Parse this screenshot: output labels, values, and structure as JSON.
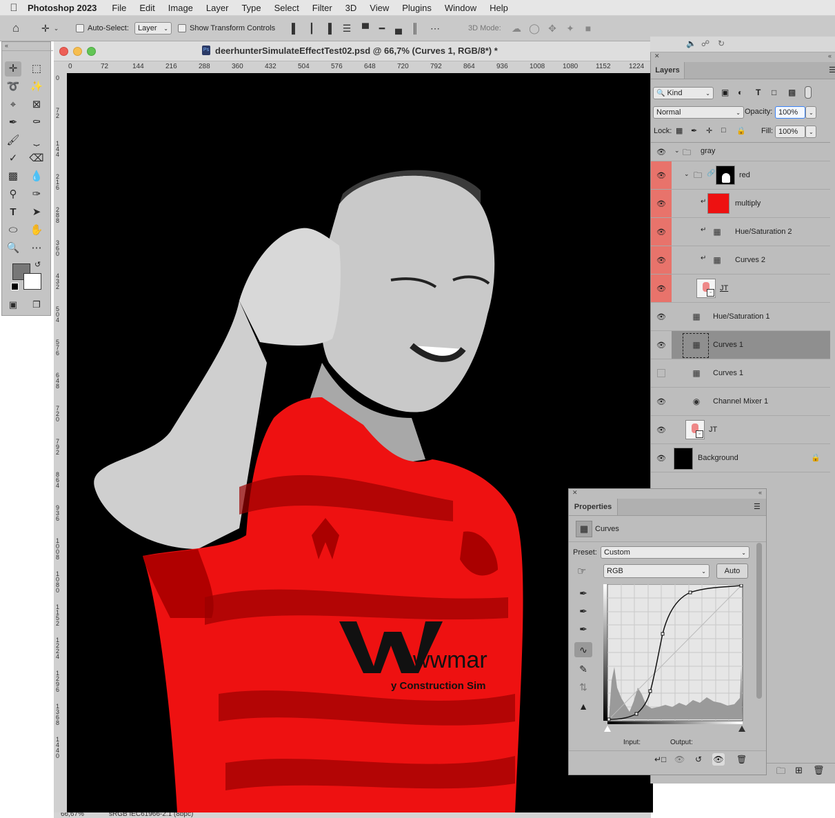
{
  "menubar": {
    "apple_icon": "apple-logo-icon",
    "app_name": "Photoshop 2023",
    "items": [
      "File",
      "Edit",
      "Image",
      "Layer",
      "Type",
      "Select",
      "Filter",
      "3D",
      "View",
      "Plugins",
      "Window",
      "Help"
    ]
  },
  "options_bar": {
    "auto_select_label": "Auto-Select:",
    "auto_select_value": "Layer",
    "show_transform_label": "Show Transform Controls",
    "mode_3d_label": "3D Mode:"
  },
  "document": {
    "title": "deerhunterSimulateEffectTest02.psd @ 66,7% (Curves 1, RGB/8*) *",
    "ruler_top": [
      "0",
      "72",
      "144",
      "216",
      "288",
      "360",
      "432",
      "504",
      "576",
      "648",
      "720",
      "792",
      "864",
      "936",
      "1008",
      "1080",
      "1152",
      "1224"
    ],
    "ruler_left": [
      "0",
      "72",
      "144",
      "216",
      "288",
      "360",
      "432",
      "504",
      "576",
      "648",
      "720",
      "792",
      "864",
      "936",
      "1008",
      "1080",
      "1152",
      "1224",
      "1296",
      "1368",
      "1440"
    ],
    "zoom": "66,67%",
    "color_profile": "sRGB IEC61966-2.1 (8bpc)"
  },
  "layers_panel": {
    "tab": "Layers",
    "filter_kind": "Kind",
    "blend_mode": "Normal",
    "opacity_label": "Opacity:",
    "opacity_value": "100%",
    "lock_label": "Lock:",
    "fill_label": "Fill:",
    "fill_value": "100%",
    "layers": [
      {
        "name": "gray",
        "type": "group"
      },
      {
        "name": "red",
        "type": "group-masked"
      },
      {
        "name": "multiply",
        "type": "fill"
      },
      {
        "name": "Hue/Saturation 2",
        "type": "adjustment"
      },
      {
        "name": "Curves 2",
        "type": "adjustment"
      },
      {
        "name": "JT",
        "type": "smart-object"
      },
      {
        "name": "Hue/Saturation 1",
        "type": "adjustment"
      },
      {
        "name": "Curves 1",
        "type": "adjustment-selected"
      },
      {
        "name": "Curves 1",
        "type": "adjustment-hidden"
      },
      {
        "name": "Channel Mixer 1",
        "type": "adjustment"
      },
      {
        "name": "JT",
        "type": "smart-object"
      },
      {
        "name": "Background",
        "type": "locked"
      }
    ]
  },
  "properties_panel": {
    "tab": "Properties",
    "adjustment_name": "Curves",
    "preset_label": "Preset:",
    "preset_value": "Custom",
    "channel_value": "RGB",
    "auto_button": "Auto",
    "input_label": "Input:",
    "output_label": "Output:"
  },
  "colors": {
    "foreground": "#777777",
    "background": "#ffffff",
    "accent_red": "#e8736b",
    "shirt_red": "#ee1111"
  },
  "image_text": {
    "sponsor": "wwmar",
    "sponsor_sub": "y Construction Sim"
  }
}
